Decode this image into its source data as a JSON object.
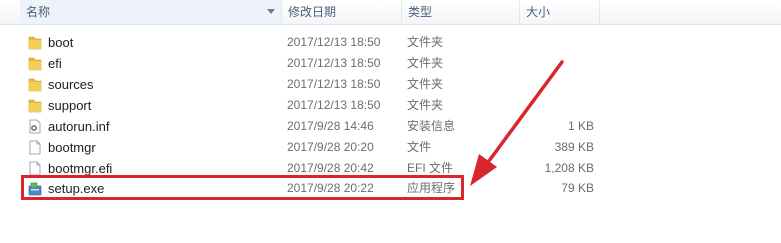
{
  "columns": {
    "name": "名称",
    "date": "修改日期",
    "type": "类型",
    "size": "大小"
  },
  "files": [
    {
      "name": "boot",
      "date": "2017/12/13 18:50",
      "type": "文件夹",
      "size": "",
      "icon": "folder-icon"
    },
    {
      "name": "efi",
      "date": "2017/12/13 18:50",
      "type": "文件夹",
      "size": "",
      "icon": "folder-icon"
    },
    {
      "name": "sources",
      "date": "2017/12/13 18:50",
      "type": "文件夹",
      "size": "",
      "icon": "folder-icon"
    },
    {
      "name": "support",
      "date": "2017/12/13 18:50",
      "type": "文件夹",
      "size": "",
      "icon": "folder-icon"
    },
    {
      "name": "autorun.inf",
      "date": "2017/9/28 14:46",
      "type": "安装信息",
      "size": "1 KB",
      "icon": "settings-file-icon"
    },
    {
      "name": "bootmgr",
      "date": "2017/9/28 20:20",
      "type": "文件",
      "size": "389 KB",
      "icon": "file-icon"
    },
    {
      "name": "bootmgr.efi",
      "date": "2017/9/28 20:42",
      "type": "EFI 文件",
      "size": "1,208 KB",
      "icon": "file-icon"
    },
    {
      "name": "setup.exe",
      "date": "2017/9/28 20:22",
      "type": "应用程序",
      "size": "79 KB",
      "icon": "setup-exe-icon"
    }
  ],
  "colors": {
    "highlight": "#d8262c",
    "folder": "#e8b93a"
  }
}
